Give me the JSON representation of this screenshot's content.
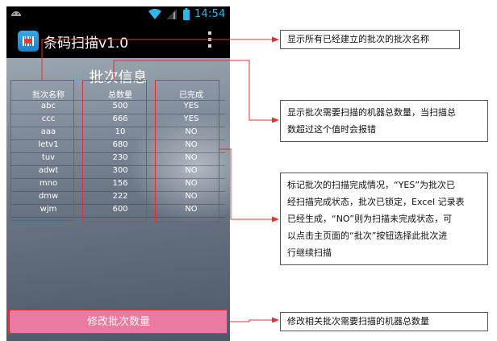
{
  "status_bar": {
    "time": "14:54",
    "icons": [
      "android-icon",
      "wifi-icon",
      "signal-icon",
      "battery-icon"
    ]
  },
  "action_bar": {
    "app_title": "条码扫描v1.0",
    "menu_icon": "overflow-menu-icon"
  },
  "screen": {
    "title": "批次信息",
    "columns": [
      "批次名称",
      "总数量",
      "已完成"
    ],
    "rows": [
      [
        "abc",
        "500",
        "YES"
      ],
      [
        "ccc",
        "666",
        "YES"
      ],
      [
        "aaa",
        "10",
        "NO"
      ],
      [
        "letv1",
        "680",
        "NO"
      ],
      [
        "tuv",
        "230",
        "NO"
      ],
      [
        "adwt",
        "300",
        "NO"
      ],
      [
        "mno",
        "156",
        "NO"
      ],
      [
        "dmw",
        "222",
        "NO"
      ],
      [
        "wjm",
        "600",
        "NO"
      ]
    ],
    "edit_button": "修改批次数量"
  },
  "callouts": {
    "batch_names": "显示所有已经建立的批次的批次名称",
    "total_count": [
      "显示批次需要扫描的机器总数量，当扫描总",
      "数超过这个值时会报错"
    ],
    "completion": [
      "标记批次的扫描完成情况，“YES”为批次已",
      "经扫描完成状态，批次已锁定，Excel 记录表",
      "已经生成，“NO”则为扫描未完成状态，可",
      "以点击主页面的“批次”按钮选择此批次进",
      "行继续扫描"
    ],
    "edit_button": "修改相关批次需要扫描的机器总数量"
  },
  "colors": {
    "annotation_line": "#e53030",
    "button": "#e97aa0",
    "status_accent": "#2fb6e8"
  }
}
